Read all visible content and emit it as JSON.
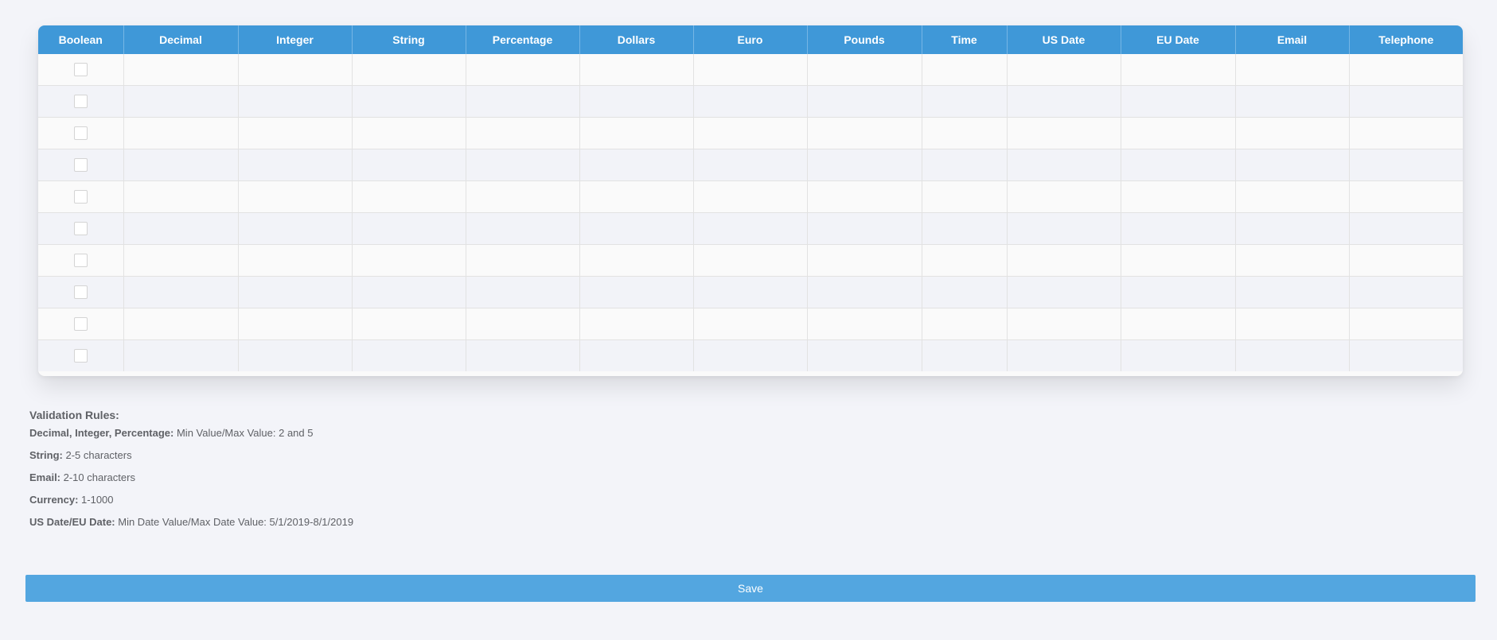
{
  "grid": {
    "columns": [
      "Boolean",
      "Decimal",
      "Integer",
      "String",
      "Percentage",
      "Dollars",
      "Euro",
      "Pounds",
      "Time",
      "US Date",
      "EU Date",
      "Email",
      "Telephone"
    ],
    "row_count": 10,
    "checked": [
      false,
      false,
      false,
      false,
      false,
      false,
      false,
      false,
      false,
      false
    ]
  },
  "validation": {
    "heading": "Validation Rules:",
    "rules": [
      {
        "label": "Decimal, Integer, Percentage:",
        "text": " Min Value/Max Value: 2 and 5"
      },
      {
        "label": "String:",
        "text": " 2-5 characters"
      },
      {
        "label": "Email:",
        "text": " 2-10 characters"
      },
      {
        "label": "Currency:",
        "text": " 1-1000"
      },
      {
        "label": "US Date/EU Date:",
        "text": " Min Date Value/Max Date Value: 5/1/2019-8/1/2019"
      }
    ]
  },
  "save_button": {
    "label": "Save"
  },
  "colors": {
    "header_bg": "#3f98d8",
    "save_bg": "#53a6e0",
    "page_bg": "#f3f4f9"
  }
}
